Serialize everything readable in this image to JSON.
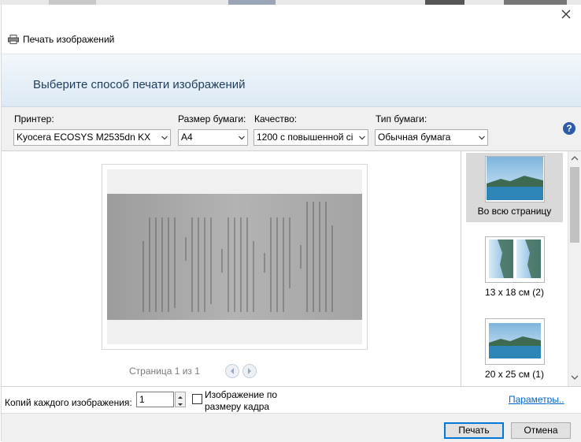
{
  "window": {
    "title": "Печать изображений",
    "heading": "Выберите способ печати изображений",
    "close_icon": "close-icon"
  },
  "settings": {
    "printer": {
      "label": "Принтер:",
      "value": "Kyocera ECOSYS M2535dn KX"
    },
    "paper_size": {
      "label": "Размер бумаги:",
      "value": "A4"
    },
    "quality": {
      "label": "Качество:",
      "value": "1200 с повышенной сі"
    },
    "paper_type": {
      "label": "Тип бумаги:",
      "value": "Обычная бумага"
    },
    "help_glyph": "?"
  },
  "preview": {
    "page_indicator": "Страница 1 из 1"
  },
  "layouts": [
    {
      "label": "Во всю страницу",
      "selected": true
    },
    {
      "label": "13 x 18 см (2)",
      "selected": false
    },
    {
      "label": "20 x 25 см (1)",
      "selected": false
    }
  ],
  "options": {
    "copies_label": "Копий каждого изображения:",
    "copies_value": "1",
    "fit_label_line1": "Изображение по",
    "fit_label_line2": "размеру кадра",
    "fit_checked": false,
    "params_link": "Параметры.."
  },
  "buttons": {
    "print": "Печать",
    "cancel": "Отмена"
  },
  "colors": {
    "banner_text": "#1e3d5c",
    "link": "#0066cc",
    "help_badge": "#2a5aa8",
    "primary_border": "#0078d7"
  }
}
